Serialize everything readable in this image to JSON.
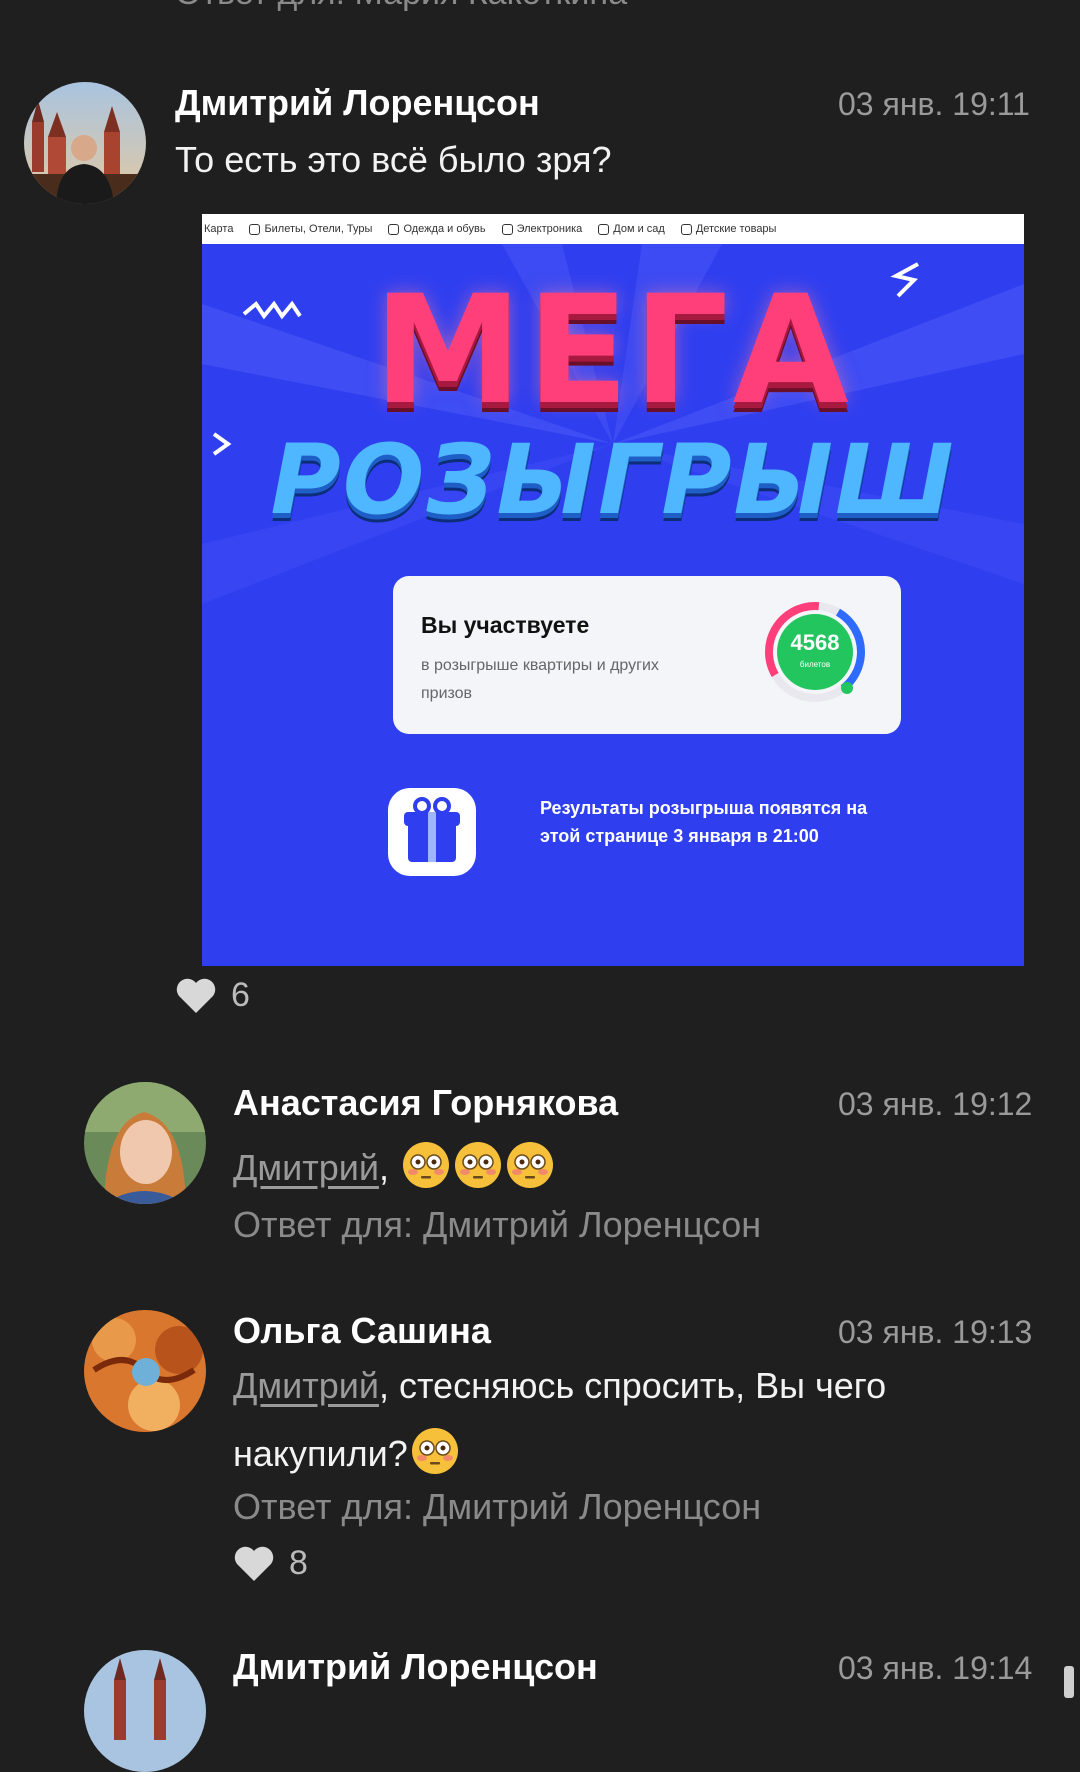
{
  "top_cut_text": "Ответ для: Мария Какоткина",
  "comments": [
    {
      "author": "Дмитрий Лоренцсон",
      "time": "03 янв. 19:11",
      "text": "То есть это всё было зря?",
      "likes": "6",
      "attachment": {
        "nav": [
          "Карта",
          "Билеты, Отели, Туры",
          "Одежда и обувь",
          "Электроника",
          "Дом и сад",
          "Детские товары"
        ],
        "title_line1": "МЕГА",
        "title_line2": "РОЗЫГРЫШ",
        "card_title": "Вы участвуете",
        "card_sub": "в розыгрыше квартиры и других призов",
        "tickets_count": "4568",
        "tickets_label": "билетов",
        "result_text": "Результаты розыгрыша появятся на этой странице 3 января в 21:00"
      }
    },
    {
      "author": "Анастасия Горнякова",
      "time": "03 янв. 19:12",
      "mention": "Дмитрий",
      "text": ",",
      "emojis": [
        "flushed",
        "flushed",
        "flushed"
      ],
      "reply_to": "Ответ для: Дмитрий Лоренцсон"
    },
    {
      "author": "Ольга Сашина",
      "time": "03 янв. 19:13",
      "mention": "Дмитрий",
      "text_line1": ", стесняюсь спросить, Вы чего",
      "text_line2": "накупили?",
      "emojis": [
        "flushed"
      ],
      "reply_to": "Ответ для: Дмитрий Лоренцсон",
      "likes": "8"
    },
    {
      "author": "Дмитрий Лоренцсон",
      "time": "03 янв. 19:14"
    }
  ],
  "icons": {
    "like": "heart-icon",
    "emoji": "flushed-face-icon"
  },
  "colors": {
    "background": "#1f1f1f",
    "promo_blue": "#2f3ff0",
    "ring_green": "#22c55e"
  }
}
